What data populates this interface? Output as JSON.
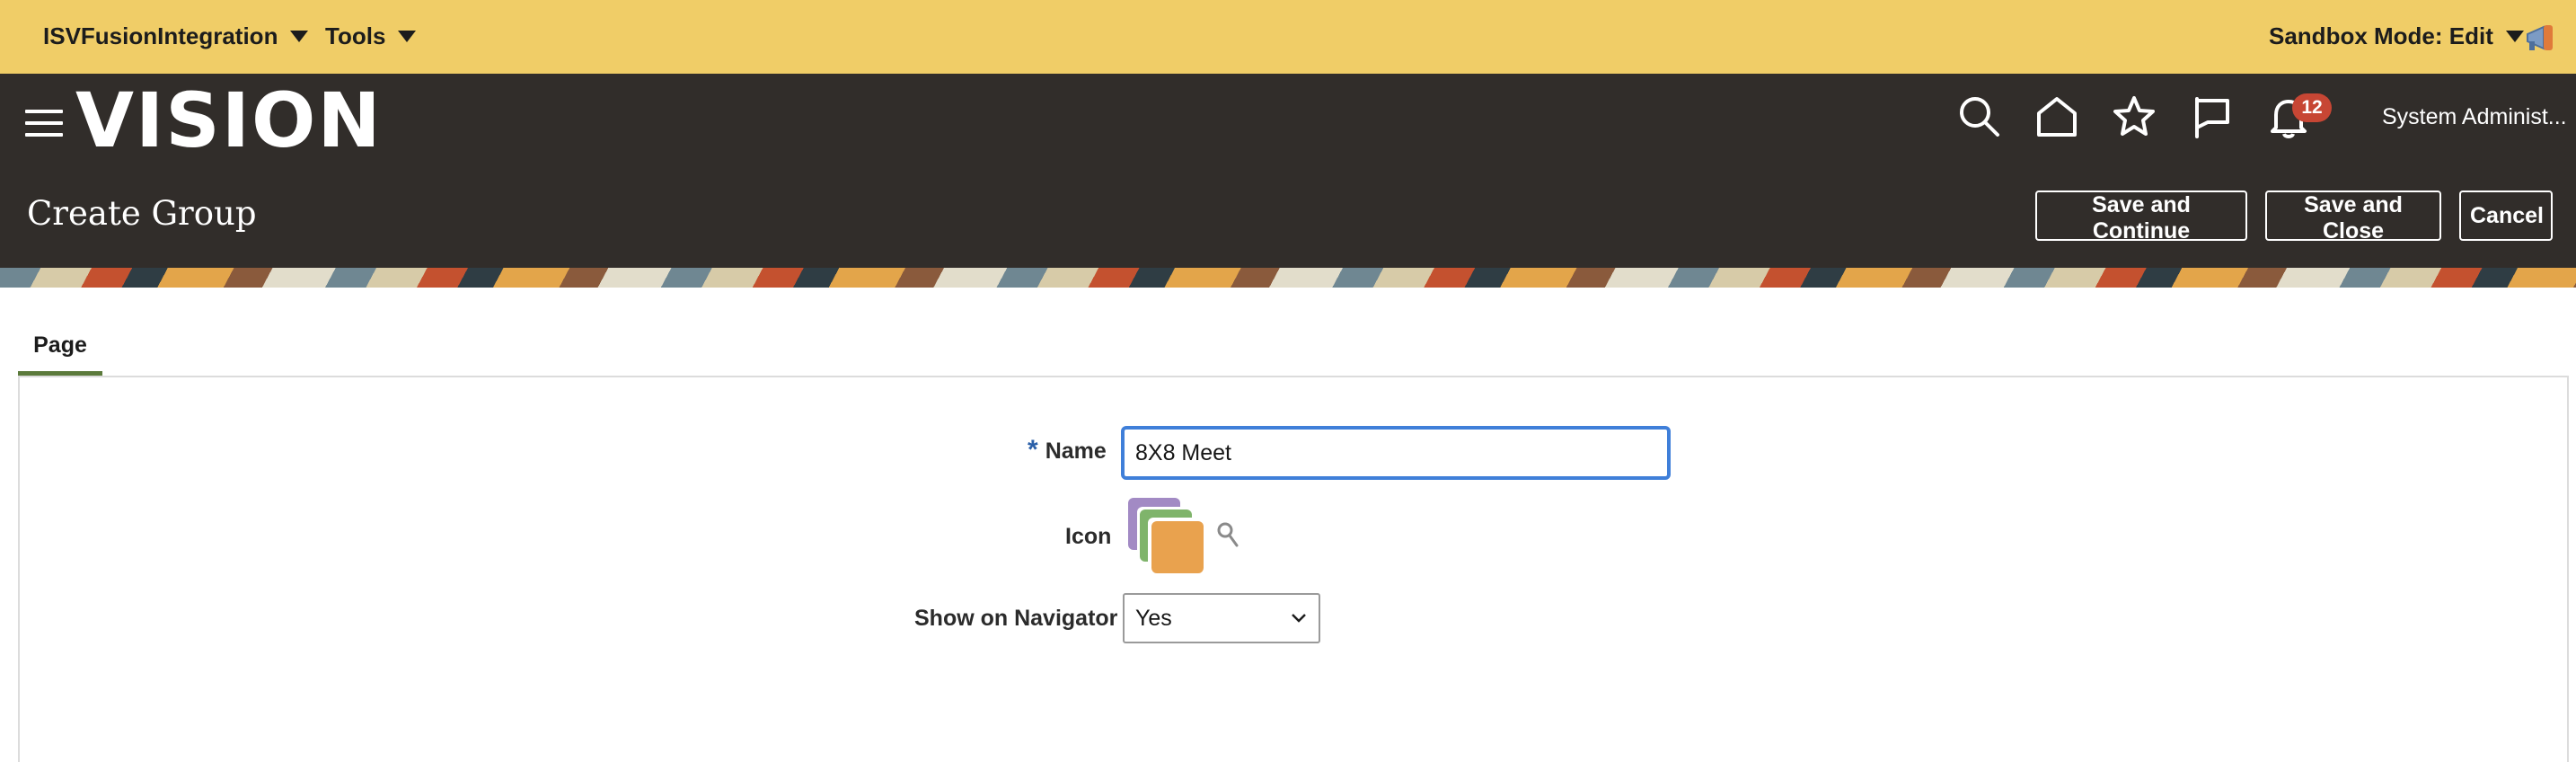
{
  "topbar": {
    "app_menu_label": "ISVFusionIntegration",
    "tools_menu_label": "Tools",
    "sandbox_label": "Sandbox Mode: Edit"
  },
  "header": {
    "logo_text": "VISION",
    "notification_count": "12",
    "user_label": "System Administ...",
    "icons": [
      "menu-icon",
      "search-icon",
      "home-icon",
      "star-icon",
      "flag-icon",
      "bell-icon",
      "megaphone-icon"
    ]
  },
  "page": {
    "title": "Create Group",
    "buttons": {
      "save_continue": "Save and Continue",
      "save_close": "Save and Close",
      "cancel": "Cancel"
    },
    "tabs": [
      {
        "label": "Page"
      }
    ]
  },
  "form": {
    "required_mark": "*",
    "name_label": "Name",
    "name_value": "8X8 Meet",
    "icon_label": "Icon",
    "navigator_label": "Show on Navigator",
    "navigator_value": "Yes"
  },
  "colors": {
    "topbar": "#f0cd67",
    "header": "#312d2a",
    "focus": "#3f7fd9",
    "badge": "#c74634",
    "tab_underline": "#5b7a3b"
  }
}
